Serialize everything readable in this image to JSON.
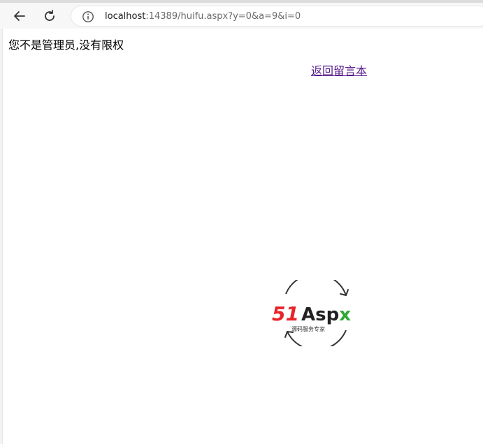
{
  "browser": {
    "back_icon": "arrow-left-icon",
    "reload_icon": "reload-icon",
    "info_icon": "info-icon",
    "url_host": "localhost",
    "url_rest": ":14389/huifu.aspx?y=0&a=9&i=0"
  },
  "page": {
    "message": "您不是管理员,没有限权",
    "back_link": "返回留言本"
  },
  "logo": {
    "number": "51",
    "brand": "Aspx",
    "subtitle": "源码服务专家",
    "colors": {
      "number": "#e8232a",
      "brand": "#222222",
      "x": "#2fa834"
    }
  }
}
